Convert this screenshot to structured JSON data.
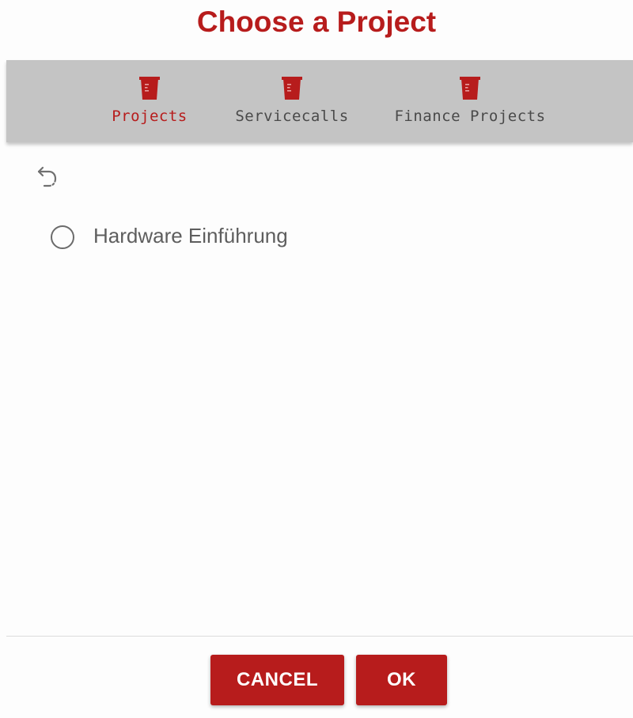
{
  "dialog": {
    "title": "Choose a Project"
  },
  "tabs": [
    {
      "label": "Projects",
      "icon": "beaker-icon",
      "active": true
    },
    {
      "label": "Servicecalls",
      "icon": "beaker-icon",
      "active": false
    },
    {
      "label": "Finance Projects",
      "icon": "beaker-icon",
      "active": false
    }
  ],
  "toolbar": {
    "back_icon": "undo-arrow-icon"
  },
  "list": {
    "items": [
      {
        "label": "Hardware Einführung",
        "selected": false
      }
    ]
  },
  "actions": {
    "cancel_label": "CANCEL",
    "ok_label": "OK"
  },
  "colors": {
    "accent": "#b71c1c",
    "tabbar_bg": "#c4c4c4",
    "inactive_text": "#4a4a4a"
  }
}
